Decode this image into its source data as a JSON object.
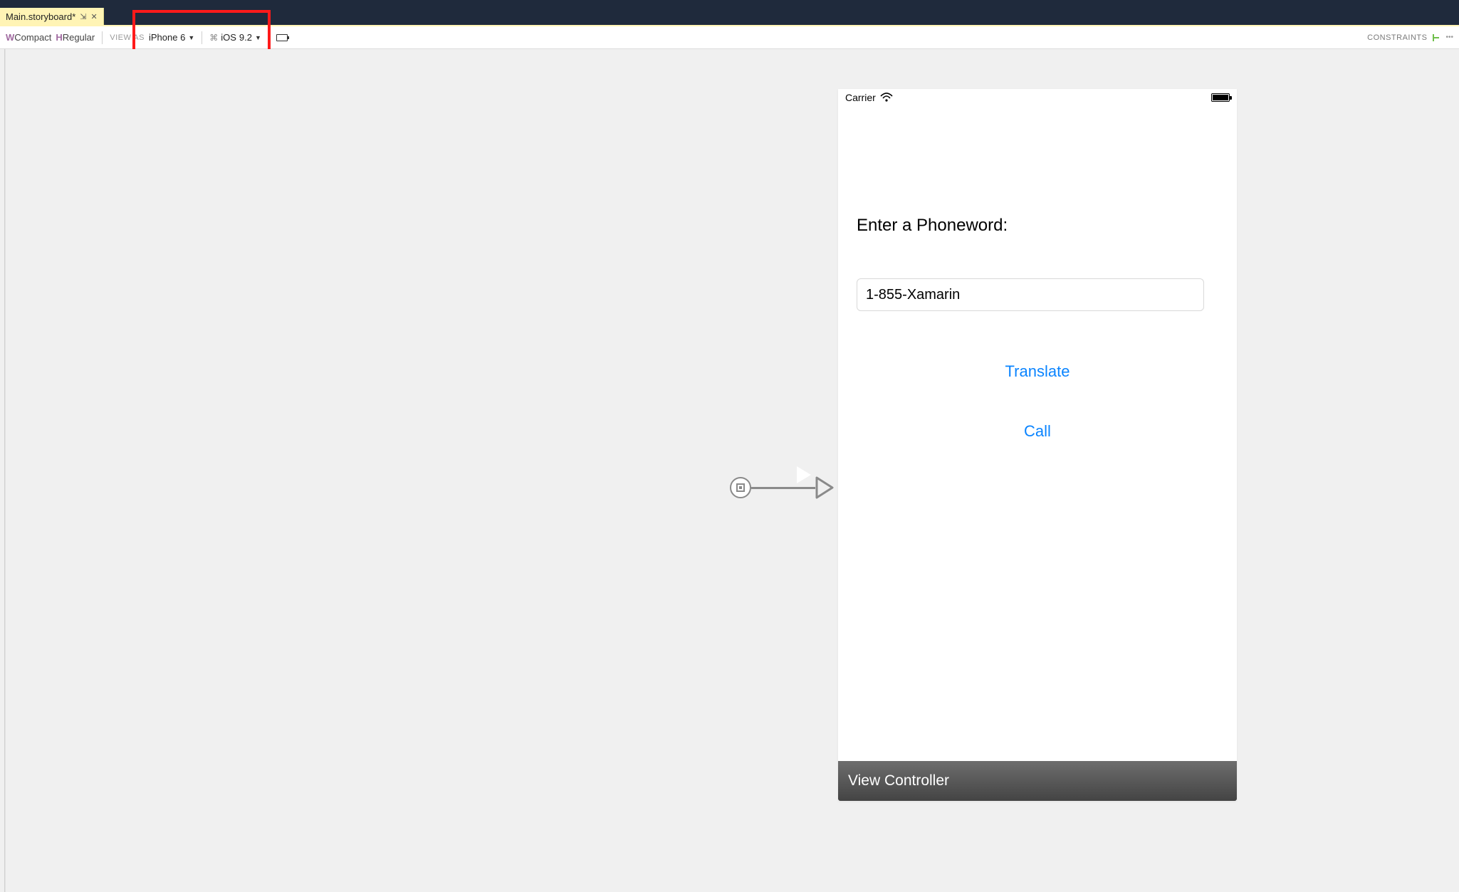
{
  "tab": {
    "title": "Main.storyboard*"
  },
  "toolbar": {
    "size_w_prefix": "W",
    "size_w": "Compact",
    "size_h_prefix": "H",
    "size_h": "Regular",
    "view_as_label": "VIEW AS",
    "device": "iPhone 6",
    "ios_prefix": "iOS",
    "ios_version": "9.2",
    "constraints_label": "CONSTRAINTS"
  },
  "phone": {
    "carrier": "Carrier",
    "label": "Enter a Phoneword:",
    "input_value": "1-855-Xamarin",
    "translate_button": "Translate",
    "call_button": "Call",
    "vc_title": "View Controller"
  },
  "colors": {
    "ios_link": "#0a84ff",
    "dark_bar": "#1f2a3c",
    "tab_bg": "#fff4b5",
    "annotation_red": "#ff1a1a"
  }
}
